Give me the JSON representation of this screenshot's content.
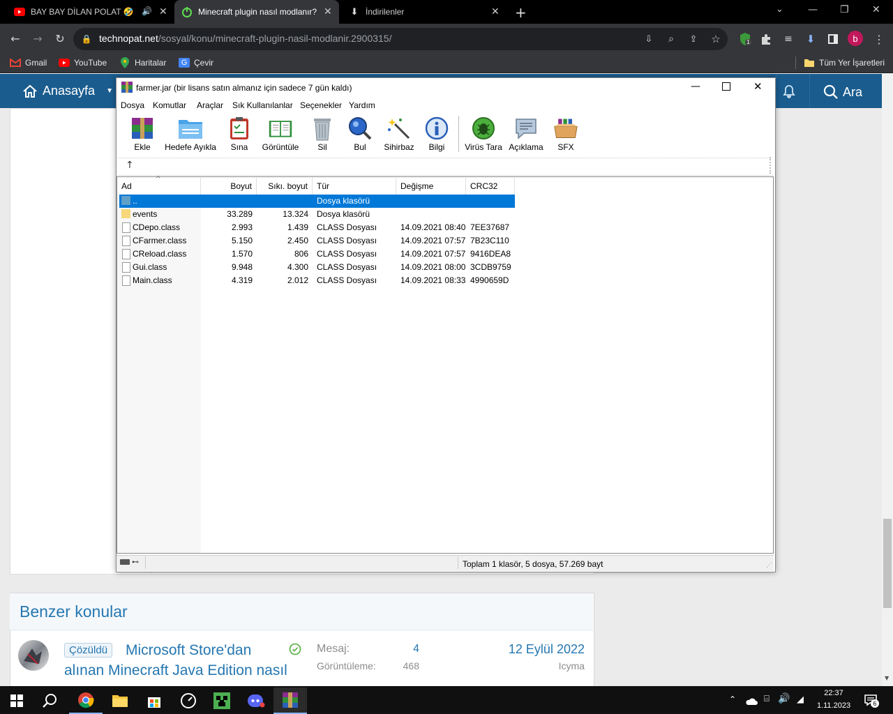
{
  "browser": {
    "tabs": [
      {
        "title": "BAY BAY DİLAN POLAT 🤣 -",
        "favicon": "youtube-icon",
        "active": false
      },
      {
        "title": "Minecraft plugin nasıl modlanır?",
        "favicon": "power-icon",
        "active": true
      },
      {
        "title": "İndirilenler",
        "favicon": "download-icon",
        "active": false
      }
    ],
    "url_domain": "technopat.net",
    "url_path": "/sosyal/konu/minecraft-plugin-nasil-modlanir.2900315/",
    "bookmarks": [
      {
        "label": "Gmail",
        "icon": "gmail-icon"
      },
      {
        "label": "YouTube",
        "icon": "youtube-icon"
      },
      {
        "label": "Haritalar",
        "icon": "maps-icon"
      },
      {
        "label": "Çevir",
        "icon": "translate-icon"
      }
    ],
    "all_bookmarks_label": "Tüm Yer İşaretleri",
    "profile_initial": "b",
    "shield_badge": "1"
  },
  "site": {
    "nav_home": "Anasayfa",
    "nav_search": "Ara",
    "similar_title": "Benzer konular",
    "thread": {
      "badge": "Çözüldü",
      "title_line1": "Microsoft Store'dan",
      "title_line2": "alınan Minecraft Java Edition nasıl",
      "messages_label": "Mesaj:",
      "messages_value": "4",
      "views_label": "Görüntüleme:",
      "views_value": "468",
      "date": "12 Eylül 2022",
      "author": "Icyma"
    }
  },
  "winrar": {
    "title": "farmer.jar (bir lisans satın almanız için sadece 7 gün kaldı)",
    "menu": [
      "Dosya",
      "Komutlar",
      "Araçlar",
      "Sık Kullanılanlar",
      "Seçenekler",
      "Yardım"
    ],
    "toolbar": [
      "Ekle",
      "Hedefe Ayıkla",
      "Sına",
      "Görüntüle",
      "Sil",
      "Bul",
      "Sihirbaz",
      "Bilgi",
      "Virüs Tara",
      "Açıklama",
      "SFX"
    ],
    "columns": [
      "Ad",
      "Boyut",
      "Sıkı. boyut",
      "Tür",
      "Değişme",
      "CRC32"
    ],
    "rows": [
      {
        "name": "..",
        "size": "",
        "packed": "",
        "type": "Dosya klasörü",
        "modified": "",
        "crc": "",
        "kind": "up"
      },
      {
        "name": "events",
        "size": "33.289",
        "packed": "13.324",
        "type": "Dosya klasörü",
        "modified": "",
        "crc": "",
        "kind": "folder"
      },
      {
        "name": "CDepo.class",
        "size": "2.993",
        "packed": "1.439",
        "type": "CLASS Dosyası",
        "modified": "14.09.2021 08:40",
        "crc": "7EE37687",
        "kind": "file"
      },
      {
        "name": "CFarmer.class",
        "size": "5.150",
        "packed": "2.450",
        "type": "CLASS Dosyası",
        "modified": "14.09.2021 07:57",
        "crc": "7B23C110",
        "kind": "file"
      },
      {
        "name": "CReload.class",
        "size": "1.570",
        "packed": "806",
        "type": "CLASS Dosyası",
        "modified": "14.09.2021 07:57",
        "crc": "9416DEA8",
        "kind": "file"
      },
      {
        "name": "Gui.class",
        "size": "9.948",
        "packed": "4.300",
        "type": "CLASS Dosyası",
        "modified": "14.09.2021 08:00",
        "crc": "3CDB9759",
        "kind": "file"
      },
      {
        "name": "Main.class",
        "size": "4.319",
        "packed": "2.012",
        "type": "CLASS Dosyası",
        "modified": "14.09.2021 08:33",
        "crc": "4990659D",
        "kind": "file"
      }
    ],
    "status": "Toplam 1 klasör, 5 dosya, 57.269 bayt"
  },
  "taskbar": {
    "time": "22:37",
    "date": "1.11.2023",
    "notification_count": "6"
  },
  "colors": {
    "site_nav": "#1a5c8e",
    "link": "#2577b1",
    "selection": "#0078d7"
  }
}
